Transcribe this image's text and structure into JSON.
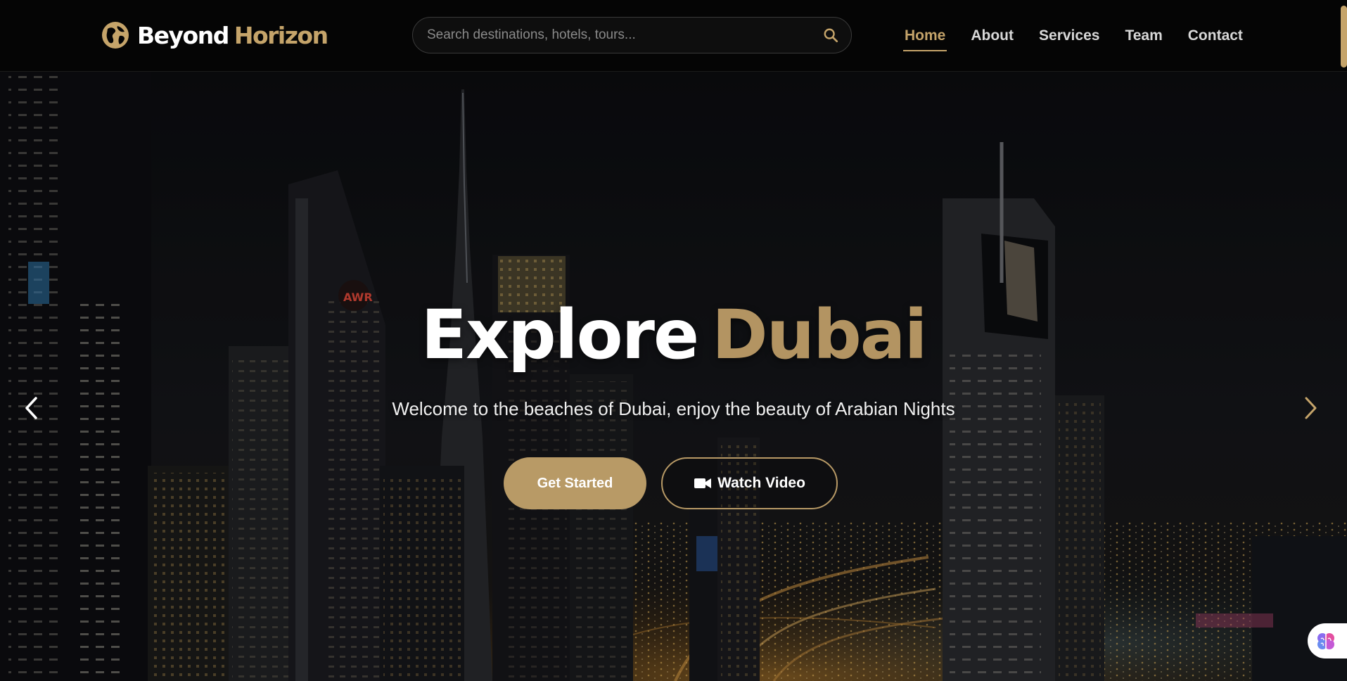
{
  "brand": {
    "name_part1": "Beyond",
    "name_part2": "Horizon",
    "icon": "globe-icon",
    "accent_color": "#c5a46a"
  },
  "search": {
    "placeholder": "Search destinations, hotels, tours...",
    "value": "",
    "icon": "search-icon"
  },
  "nav": {
    "items": [
      {
        "label": "Home",
        "active": true
      },
      {
        "label": "About",
        "active": false
      },
      {
        "label": "Services",
        "active": false
      },
      {
        "label": "Team",
        "active": false
      },
      {
        "label": "Contact",
        "active": false
      }
    ]
  },
  "hero": {
    "title_part1": "Explore",
    "title_part2": "Dubai",
    "subtitle": "Welcome to the beaches of Dubai, enjoy the beauty of Arabian Nights",
    "primary_button": "Get Started",
    "secondary_button": "Watch Video",
    "secondary_button_icon": "video-camera-icon",
    "prev_icon": "chevron-left-icon",
    "next_icon": "chevron-right-icon",
    "background": "night-city-skyline-image",
    "title_accent_color": "#b39462",
    "button_color": "#b89a66"
  },
  "assistant": {
    "icon": "brain-icon"
  }
}
